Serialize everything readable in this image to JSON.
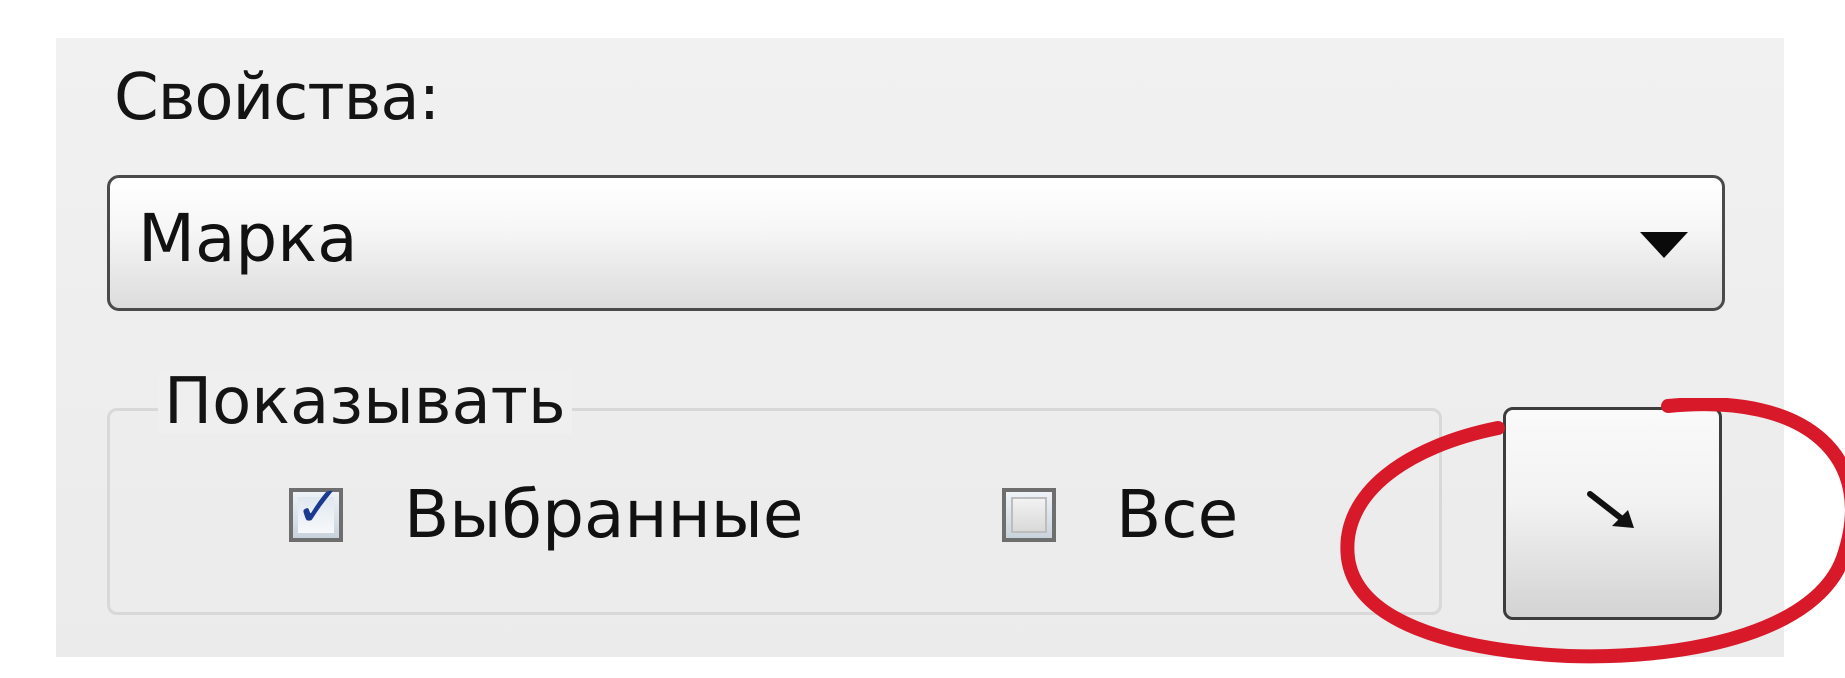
{
  "properties": {
    "label": "Свойства:",
    "combo_value": "Марка",
    "combo_arrow_icon": "triangle-down-icon"
  },
  "show_group": {
    "legend": "Показывать",
    "options": [
      {
        "label": "Выбранные",
        "checked": true
      },
      {
        "label": "Все",
        "checked": false
      }
    ]
  },
  "action_button": {
    "icon": "arrow-down-right-icon"
  },
  "annotation": {
    "color": "#d8192a"
  }
}
